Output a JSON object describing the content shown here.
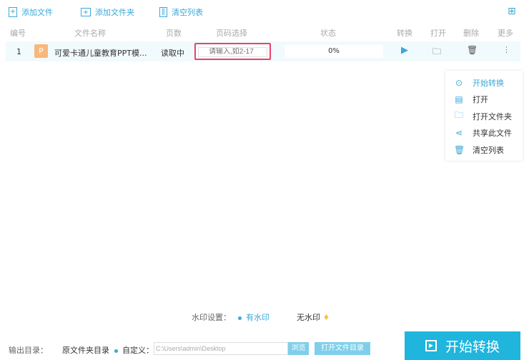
{
  "toolbar": {
    "add_file": "添加文件",
    "add_folder": "添加文件夹",
    "clear_list": "清空列表"
  },
  "columns": {
    "index": "编号",
    "name": "文件名称",
    "pages": "页数",
    "page_select": "页码选择",
    "status": "状态",
    "convert": "转换",
    "open": "打开",
    "delete": "删除",
    "more": "更多"
  },
  "rows": [
    {
      "index": "1",
      "icon_letter": "P",
      "name": "可爱卡通儿童教育PPT模...",
      "pages": "读取中",
      "page_placeholder": "请输入,如2-17",
      "progress": "0%"
    }
  ],
  "context_menu": [
    "开始转换",
    "打开",
    "打开文件夹",
    "共享此文件",
    "清空列表"
  ],
  "watermark": {
    "label": "水印设置：",
    "with": "有水印",
    "without": "无水印"
  },
  "output": {
    "label": "输出目录：",
    "original": "原文件夹目录",
    "custom": "自定义：",
    "path": "C:\\Users\\admin\\Desktop",
    "browse": "浏览",
    "open_dir": "打开文件目录"
  },
  "start_button": "开始转换",
  "colors": {
    "accent": "#3aa8d8",
    "start": "#1fb5dc"
  }
}
